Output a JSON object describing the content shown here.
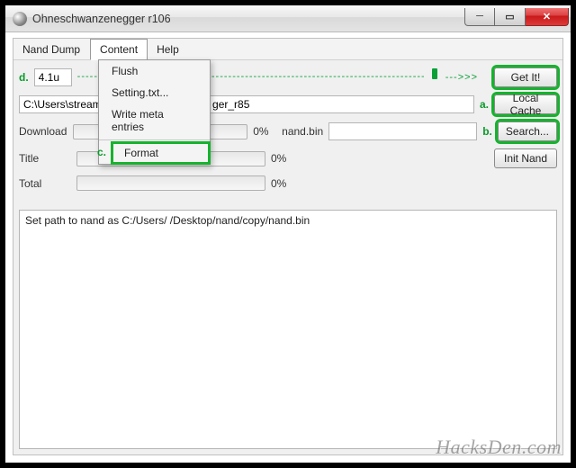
{
  "window": {
    "title": "Ohneschwanzenegger   r106"
  },
  "menu": {
    "nand_dump": "Nand Dump",
    "content": "Content",
    "help": "Help"
  },
  "dropdown": {
    "flush": "Flush",
    "setting": "Setting.txt...",
    "write_meta": "Write meta entries",
    "format": "Format"
  },
  "annotations": {
    "a": "a.",
    "b": "b.",
    "c": "c.",
    "d": "d."
  },
  "version_field": {
    "value": "4.1u"
  },
  "dash": "---------------------------------------------------------------------------------------------",
  "arrow": "--->>>",
  "path_field": {
    "value": "C:\\Users\\stream                                     ger_r85"
  },
  "nand_field": {
    "label": "nand.bin",
    "value": ""
  },
  "buttons": {
    "get_it": "Get It!",
    "local_cache": "Local Cache",
    "search": "Search...",
    "init_nand": "Init Nand"
  },
  "progress": {
    "download_label": "Download",
    "title_label": "Title",
    "total_label": "Total",
    "pct": "0%"
  },
  "log": {
    "line1": "Set path to nand as C:/Users/ /Desktop/nand/copy/nand.bin"
  },
  "watermark": "HacksDen.com"
}
